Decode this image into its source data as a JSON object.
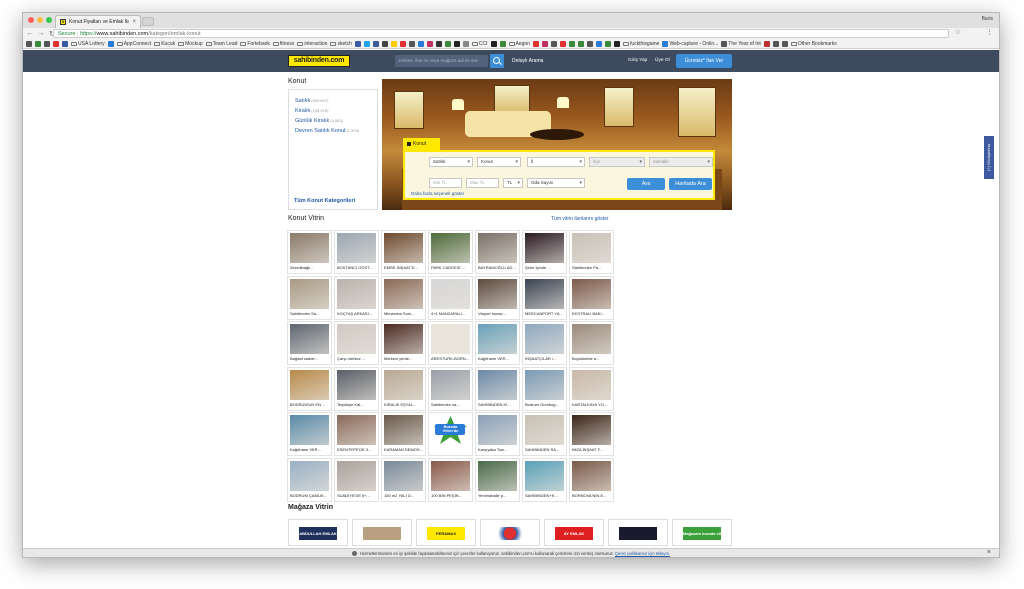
{
  "browser": {
    "tab_title": "Konut Fiyatları ve Emlak İlanları",
    "tab_favicon": "S",
    "tab_close": "×",
    "profile": "Baris",
    "url_secure": "Secure",
    "url_scheme": "https://",
    "url_host": "www.sahibinden.com",
    "url_path": "/kategori/emlak-konut",
    "nav_icons": [
      "back-icon",
      "forward-icon",
      "reload-icon"
    ],
    "bookmarks": [
      "USA Lottery",
      "AppConnect",
      "Kucuk",
      "Mockup",
      "Team Lead",
      "Fortebank",
      "fitness",
      "interaction",
      "sketch",
      "CCI",
      "Aegon",
      "fuckthisgame",
      "Web-capture - Onlin...",
      "The Year of Int",
      "Other Bookmarks"
    ]
  },
  "header": {
    "logo": "sahibinden.com",
    "search_placeholder": "Kelime, ilan no veya mağaza adı ile ara",
    "detayli": "Detaylı Arama",
    "giris": "Giriş Yap",
    "uye": "Üye Ol",
    "ilan_ver": "Ücretsiz* İlan Ver"
  },
  "sidebar": {
    "title": "Konut",
    "items": [
      {
        "label": "Satılık",
        "count": "(509.807)"
      },
      {
        "label": "Kiralık",
        "count": "(135.915)"
      },
      {
        "label": "Günlük Kiralık",
        "count": "(4.552)"
      },
      {
        "label": "Devren Satılık Konut",
        "count": "(1.593)"
      }
    ],
    "all": "Tüm Konut Kategorileri"
  },
  "search_panel": {
    "tab": "Konut",
    "sel_type": "Satılık",
    "sel_category": "Konut",
    "sel_city": "İl",
    "sel_district": "İlçe",
    "sel_neighborhood": "Mahalle",
    "min_price": "Min TL",
    "max_price": "Max TL",
    "currency": "TL",
    "rooms": "Oda Sayısı",
    "search_btn": "Ara",
    "map_btn": "Haritada Ara",
    "more": "Daha fazla seçenek göster"
  },
  "vitrin": {
    "title": "Konut Vitrin",
    "all_link": "Tüm vitrin ilanlarını göster",
    "items": [
      {
        "caption": "Zincirlibağlı...",
        "color": "#8a7a6a"
      },
      {
        "caption": "BOSTANCI GÖST...",
        "color": "#9aa6b2"
      },
      {
        "caption": "EMRE İNŞAAT'D...",
        "color": "#6e4a2e"
      },
      {
        "caption": "PARK CADDESİ ...",
        "color": "#4e6a3a"
      },
      {
        "caption": "BAYRAMOĞLU AD...",
        "color": "#7a7066"
      },
      {
        "caption": "Şehir İçinde ...",
        "color": "#2a1a22"
      },
      {
        "caption": "Sahibinden Pa...",
        "color": "#c8c0b6"
      },
      {
        "caption": "Sahibinden Sa...",
        "color": "#a89a84"
      },
      {
        "caption": "KOÇTAŞ ARKASI...",
        "color": "#b8b4ac"
      },
      {
        "caption": "Mimaroba Suni...",
        "color": "#8a6a56"
      },
      {
        "caption": "4+1 MANZARALI...",
        "color": "#d6d6d6"
      },
      {
        "caption": "Viaport house...",
        "color": "#5c4a3e"
      },
      {
        "caption": "MERCANPORT YA...",
        "color": "#3a4452"
      },
      {
        "caption": "EKSTRALI BAKI...",
        "color": "#7c5a4a"
      },
      {
        "caption": "Bağdat cadde...",
        "color": "#5e6670"
      },
      {
        "caption": "Çarşı merkez ...",
        "color": "#cfcac2"
      },
      {
        "caption": "Merkezi yerde...",
        "color": "#4a2a22"
      },
      {
        "caption": "ARESTURK-BORN...",
        "color": "#e8e4da"
      },
      {
        "caption": "Kağıthane VER...",
        "color": "#6aa0b8"
      },
      {
        "caption": "İNŞAATÇILAR /...",
        "color": "#8fa8c0"
      },
      {
        "caption": "Boyokkelde a...",
        "color": "#9a8a7c"
      },
      {
        "caption": "BODRUM'UN EN ...",
        "color": "#b88a4a"
      },
      {
        "caption": "Teşvikiye Kal...",
        "color": "#5a5e66"
      },
      {
        "caption": "KİRALIK EŞYAL...",
        "color": "#b8a894"
      },
      {
        "caption": "Sahibinden sa...",
        "color": "#9aa0a8"
      },
      {
        "caption": "SAHİBİNDEN Kİ...",
        "color": "#6c8aa8"
      },
      {
        "caption": "Bodrum Gumbog...",
        "color": "#7a9ab4"
      },
      {
        "caption": "KARTALKAYA YO...",
        "color": "#c8b8a8"
      },
      {
        "caption": "Kağıthane VER...",
        "color": "#5a8aa8"
      },
      {
        "caption": "ESENTEPE'DE 3...",
        "color": "#8a6a5a"
      },
      {
        "caption": "KARAMAN DEMOS...",
        "color": "#6a5a4c"
      },
      {
        "caption": "",
        "color": "#3a9a3a"
      },
      {
        "caption": "Karşıyaka Tow...",
        "color": "#8aa0b8"
      },
      {
        "caption": "SAHİBİNDEN SA...",
        "color": "#c8c0b4"
      },
      {
        "caption": "İMZA İNŞAAT F...",
        "color": "#3a2418"
      },
      {
        "caption": "BODRUM ÇAMLIK...",
        "color": "#9ab0c4"
      },
      {
        "caption": "SUADİYE'DE 5+...",
        "color": "#a8a49c"
      },
      {
        "caption": "150 m2 YALI D...",
        "color": "#7a8a9a"
      },
      {
        "caption": "100 BİN PEŞİN...",
        "color": "#8a5a4a"
      },
      {
        "caption": "Yenimahalle p...",
        "color": "#4a6a4a"
      },
      {
        "caption": "SAHİBİNDEN+K...",
        "color": "#5aa0b8"
      },
      {
        "caption": "BORNOVA'NIN E...",
        "color": "#7a5a4a"
      }
    ]
  },
  "badge": {
    "line1": "Burada",
    "line2": "Vitrin'de"
  },
  "magaza": {
    "title": "Mağaza Vitrin",
    "items": [
      {
        "logo": "ABDULLAH EMLAK",
        "color": "#1f2f5c"
      },
      {
        "logo": "",
        "color": "#b8a080"
      },
      {
        "logo": "PERAMAX",
        "color": "#ffe800"
      },
      {
        "logo": "",
        "color": "#ffffff"
      },
      {
        "logo": "AY EMLAK",
        "color": "#e02020"
      },
      {
        "logo": "",
        "color": "#1a1a2e"
      },
      {
        "logo": "Mağazam burada vitrinde",
        "color": "#3aa03a"
      }
    ]
  },
  "cookie": {
    "text": "Hizmetlerimizden en iyi şekilde faydalanabilmeniz için çerezler kullanıyoruz. sahibinden.com'u kullanarak çerezlere izin vermiş olursunuz.",
    "link": "Çerez politikamız için tıklayın.",
    "close": "×"
  },
  "feedback": "(+) Görüşleriniz"
}
